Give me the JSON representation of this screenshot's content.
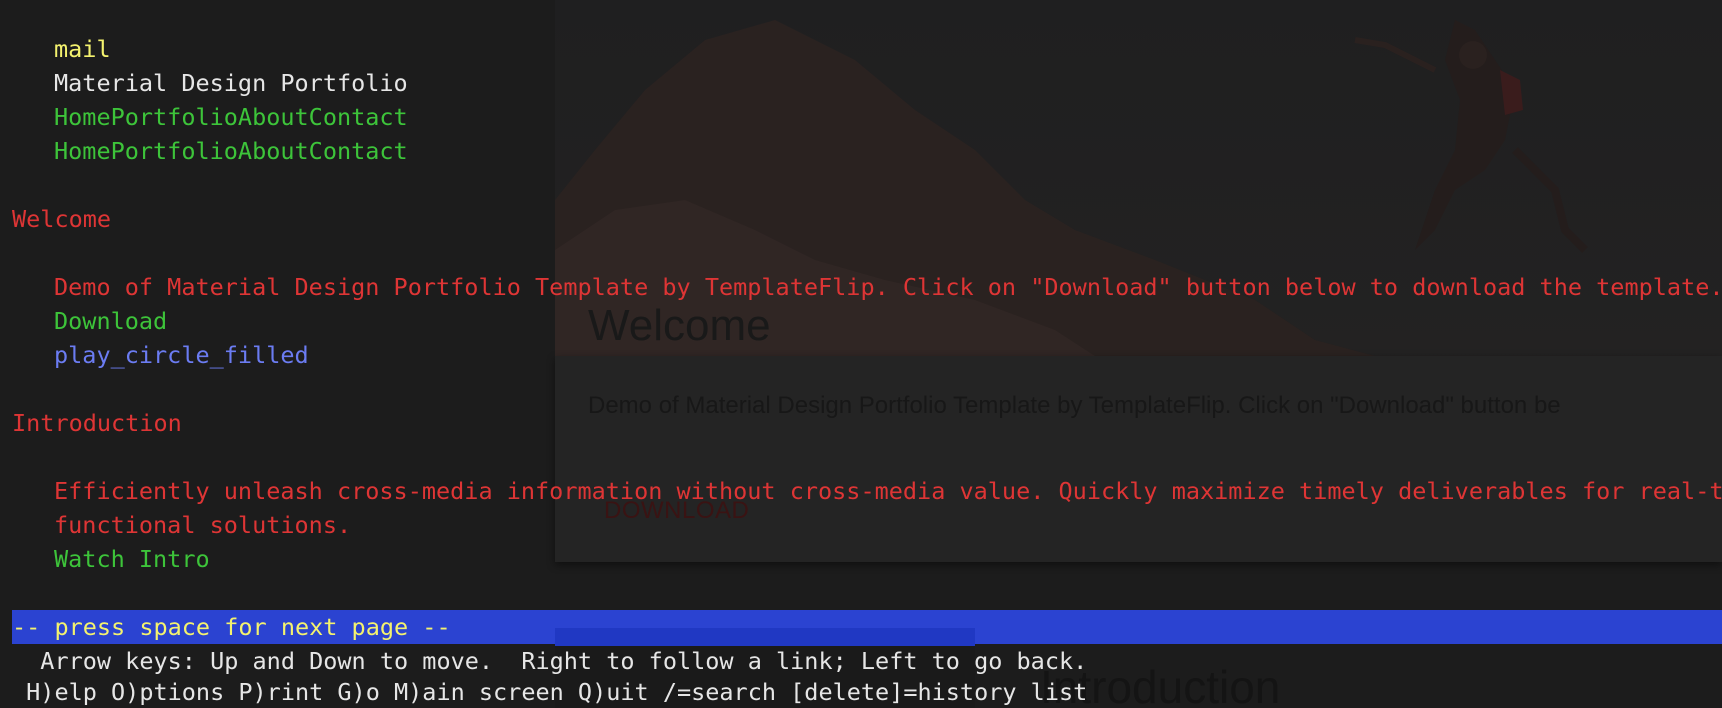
{
  "background_page": {
    "welcome_heading": "Welcome",
    "welcome_text": "Demo of Material Design Portfolio Template by TemplateFlip. Click on \"Download\" button be",
    "download_button": "DOWNLOAD",
    "introduction_heading": "Introduction"
  },
  "terminal": {
    "lines": [
      {
        "text": "mail"
      },
      {
        "text": "Material Design Portfolio"
      },
      {
        "text": "HomePortfolioAboutContact"
      },
      {
        "text": "HomePortfolioAboutContact"
      },
      {
        "text": "Welcome"
      },
      {
        "text": "Demo of Material Design Portfolio Template by TemplateFlip. Click on \"Download\" button below to download the template."
      },
      {
        "text": "Download"
      },
      {
        "text": "play_circle_filled"
      },
      {
        "text": "Introduction"
      },
      {
        "text": "Efficiently unleash cross-media information without cross-media value. Quickly maximize timely deliverables for real-time schemas. Dramatically maintain clicks-and-mortar solutions without"
      },
      {
        "text": "functional solutions."
      },
      {
        "text": "Watch Intro"
      }
    ],
    "status_prompt": "-- press space for next page --",
    "help_line_1": "  Arrow keys: Up and Down to move.  Right to follow a link; Left to go back.",
    "help_line_2": " H)elp O)ptions P)rint G)o M)ain screen Q)uit /=search [delete]=history list"
  },
  "colors": {
    "background": "#1c1c1c",
    "link_yellow": "#f4f26e",
    "text_white": "#e6e6e6",
    "link_green": "#3dc43a",
    "heading_red": "#de3535",
    "link_blue": "#6b7cf2",
    "status_bar_blue": "#2b43d1"
  }
}
